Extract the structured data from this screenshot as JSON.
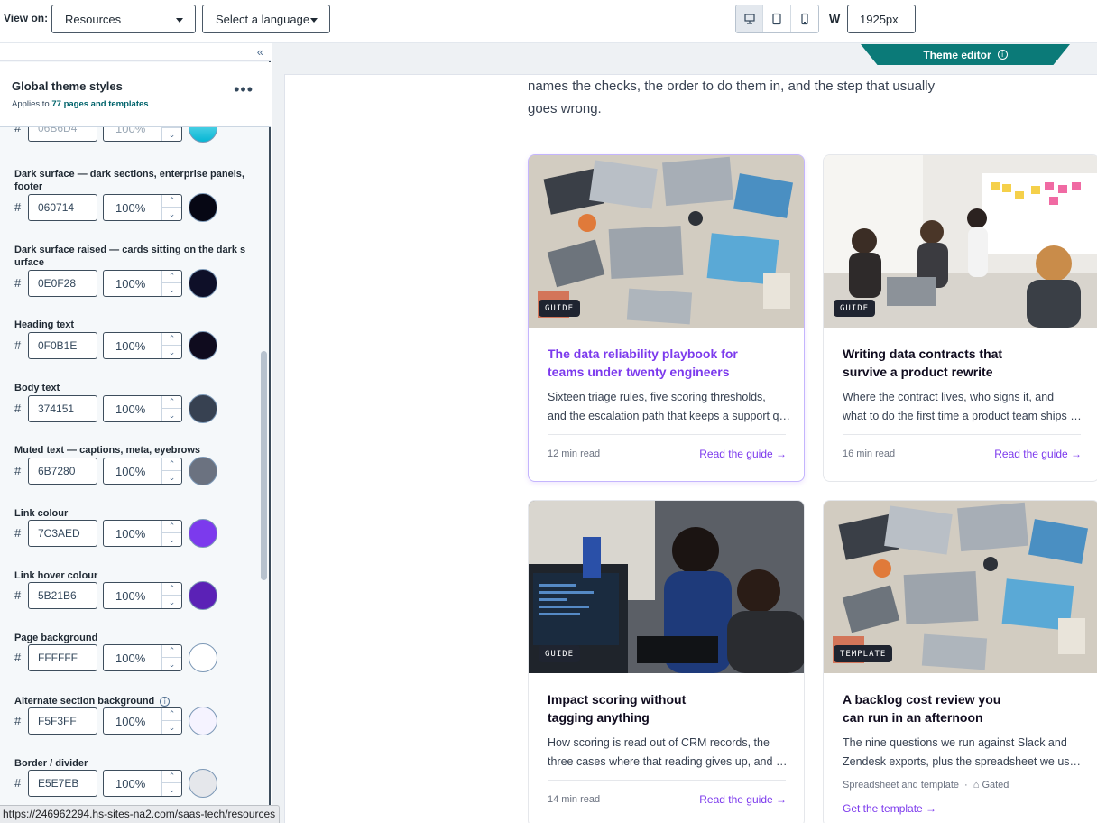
{
  "topbar": {
    "view_on_label": "View on:",
    "page_select": "Resources",
    "language_select": "Select a language",
    "width_label": "W",
    "width_value": "1925px",
    "devices": [
      "desktop-icon",
      "tablet-icon",
      "mobile-icon"
    ]
  },
  "panel": {
    "title": "Global theme styles",
    "applies_prefix": "Applies to",
    "applies_link": "77 pages and templates",
    "partial_top": {
      "hex": "06B6D4",
      "opacity": "100%",
      "color": "#06B6D4"
    },
    "fields": [
      {
        "label": "Dark surface — dark sections, enterprise panels, footer",
        "hex": "060714",
        "opacity": "100%",
        "color": "#060714",
        "info": false
      },
      {
        "label": "Dark surface raised — cards sitting on the dark surface",
        "hex": "0E0F28",
        "opacity": "100%",
        "color": "#0E0F28",
        "info": false
      },
      {
        "label": "Heading text",
        "hex": "0F0B1E",
        "opacity": "100%",
        "color": "#0F0B1E",
        "info": false
      },
      {
        "label": "Body text",
        "hex": "374151",
        "opacity": "100%",
        "color": "#374151",
        "info": false
      },
      {
        "label": "Muted text — captions, meta, eyebrows",
        "hex": "6B7280",
        "opacity": "100%",
        "color": "#6B7280",
        "info": false
      },
      {
        "label": "Link colour",
        "hex": "7C3AED",
        "opacity": "100%",
        "color": "#7C3AED",
        "info": false
      },
      {
        "label": "Link hover colour",
        "hex": "5B21B6",
        "opacity": "100%",
        "color": "#5B21B6",
        "info": false
      },
      {
        "label": "Page background",
        "hex": "FFFFFF",
        "opacity": "100%",
        "color": "#FFFFFF",
        "info": false
      },
      {
        "label": "Alternate section background",
        "hex": "F5F3FF",
        "opacity": "100%",
        "color": "#F5F3FF",
        "info": true
      },
      {
        "label": "Border / divider",
        "hex": "E5E7EB",
        "opacity": "100%",
        "color": "#E5E7EB",
        "info": false
      }
    ]
  },
  "preview": {
    "theme_editor_label": "Theme editor",
    "intro_lines": [
      "names the checks, the order to do them in, and the step that usually",
      "goes wrong."
    ],
    "cards": [
      {
        "tag": "GUIDE",
        "title_lines": [
          "The data reliability playbook for",
          "teams under twenty engineers"
        ],
        "desc_lines": [
          "Sixteen triage rules, five scoring thresholds,",
          "and the escalation path that keeps a support queue honest"
        ],
        "meta": "12 min read",
        "link": "Read the guide →"
      },
      {
        "tag": "GUIDE",
        "title_lines": [
          "Writing data contracts that",
          "survive a product rewrite"
        ],
        "desc_lines": [
          "Where the contract lives, who signs it, and",
          "what to do the first time a product team ships a breaking change"
        ],
        "meta": "16 min read",
        "link": "Read the guide →"
      },
      {
        "tag": "GUIDE",
        "title_lines": [
          "Impact scoring without",
          "tagging anything"
        ],
        "desc_lines": [
          "How scoring is read out of CRM records, the",
          "three cases where that reading gives up, and what to do"
        ],
        "meta": "14 min read",
        "link": "Read the guide →"
      },
      {
        "tag": "TEMPLATE",
        "title_lines": [
          "A backlog cost review you",
          "can run in an afternoon"
        ],
        "desc_lines": [
          "The nine questions we run against Slack and",
          "Zendesk exports, plus the spreadsheet we use to score them"
        ],
        "meta": "Spreadsheet and template",
        "gated": "Gated",
        "link": "Get the template →"
      }
    ]
  },
  "status_url": "https://246962294.hs-sites-na2.com/saas-tech/resources"
}
